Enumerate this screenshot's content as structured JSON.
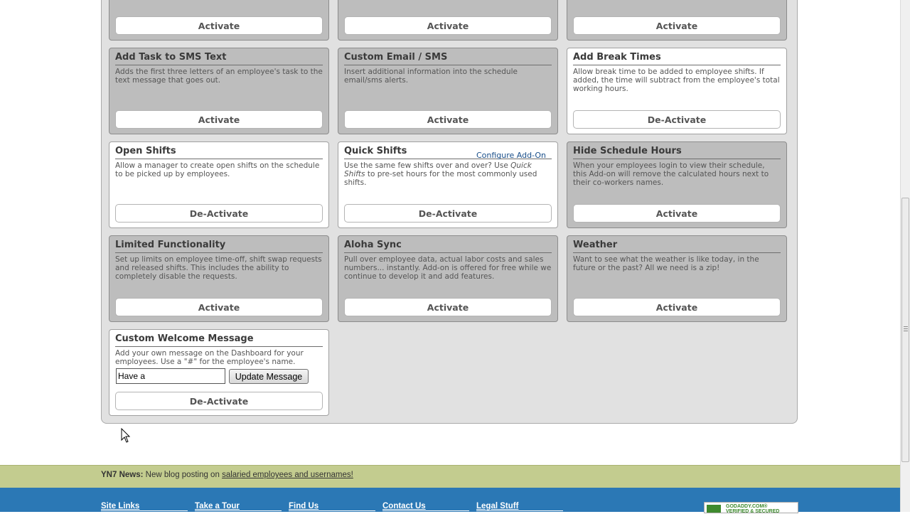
{
  "cards": [
    {
      "id": "row0-col0",
      "title": "",
      "description": "",
      "button": "Activate",
      "active": false
    },
    {
      "id": "row0-col1",
      "title": "",
      "description": "",
      "button": "Activate",
      "active": false
    },
    {
      "id": "row0-col2",
      "title": "",
      "description": "",
      "button": "Activate",
      "active": false
    },
    {
      "id": "sms-text",
      "title": "Add Task to SMS Text",
      "description": "Adds the first three letters of an employee's task to the text message that goes out.",
      "button": "Activate",
      "active": false
    },
    {
      "id": "custom-email",
      "title": "Custom Email / SMS",
      "description": "Insert additional information into the schedule email/sms alerts.",
      "button": "Activate",
      "active": false
    },
    {
      "id": "break-times",
      "title": "Add Break Times",
      "description": "Allow break time to be added to employee shifts. If added, the time will subtract from the employee's total working hours.",
      "button": "De-Activate",
      "active": true
    },
    {
      "id": "open-shifts",
      "title": "Open Shifts",
      "description": "Allow a manager to create open shifts on the schedule to be picked up by employees.",
      "button": "De-Activate",
      "active": true
    },
    {
      "id": "quick-shifts",
      "title": "Quick Shifts",
      "description_parts": [
        "Use the same few shifts over and over? Use ",
        "Quick Shifts",
        " to pre-set hours for the most commonly used shifts."
      ],
      "configure": "Configure Add-On",
      "button": "De-Activate",
      "active": true
    },
    {
      "id": "hide-hours",
      "title": "Hide Schedule Hours",
      "description": "When your employees login to view their schedule, this Add-on will remove the calculated hours next to their co-workers names.",
      "button": "Activate",
      "active": false
    },
    {
      "id": "limited",
      "title": "Limited Functionality",
      "description": "Set up limits on employee time-off, shift swap requests and released shifts. This includes the ability to completely disable the requests.",
      "button": "Activate",
      "active": false
    },
    {
      "id": "aloha",
      "title": "Aloha Sync",
      "description": "Pull over employee data, actual labor costs and sales numbers... instantly. Add-on is offered for free while we continue to develop it and add features.",
      "button": "Activate",
      "active": false
    },
    {
      "id": "weather",
      "title": "Weather",
      "description": "Want to see what the weather is like today, in the future or the past? All we need is a zip!",
      "button": "Activate",
      "active": false
    },
    {
      "id": "welcome",
      "title": "Custom Welcome Message",
      "description": "Add your own message on the Dashboard for your employees. Use a \"#\" for the employee's name.",
      "input_value": "Have a",
      "update_button": "Update Message",
      "button": "De-Activate",
      "active": true
    }
  ],
  "news": {
    "label": "YN7 News:",
    "text": "New blog posting on",
    "link": "salaried employees and usernames!"
  },
  "footer": {
    "links": [
      "Site Links",
      "Take a Tour",
      "Find Us",
      "Contact Us",
      "Legal Stuff"
    ]
  },
  "badge": {
    "line1": "GODADDY.COM®",
    "line2": "VERIFIED & SECURED"
  },
  "colors": {
    "inactive_card": "#bdbdbd",
    "active_card": "#ffffff",
    "news_bar": "#c3cc8f",
    "footer": "#2b78b5"
  }
}
